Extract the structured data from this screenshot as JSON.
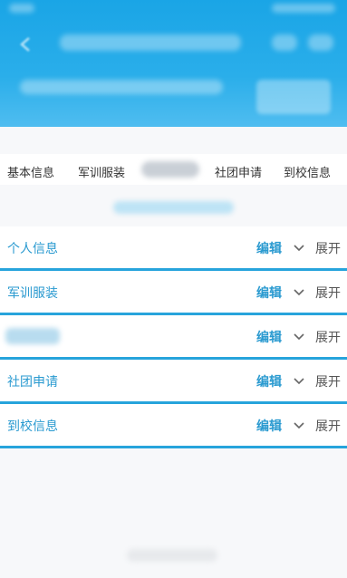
{
  "tabs": [
    "基本信息",
    "军训服装",
    "社团申请",
    "到校信息"
  ],
  "rows": [
    {
      "title": "个人信息",
      "edit": "编辑",
      "expand": "展开"
    },
    {
      "title": "军训服装",
      "edit": "编辑",
      "expand": "展开"
    },
    {
      "title": "",
      "edit": "编辑",
      "expand": "展开"
    },
    {
      "title": "社团申请",
      "edit": "编辑",
      "expand": "展开"
    },
    {
      "title": "到校信息",
      "edit": "编辑",
      "expand": "展开"
    }
  ],
  "colors": {
    "header": "#1aa5e6",
    "accent": "#2a9ad0",
    "divider": "#27a4dc"
  },
  "icons": {
    "back": "back-arrow-icon",
    "chevron": "chevron-down-icon"
  }
}
